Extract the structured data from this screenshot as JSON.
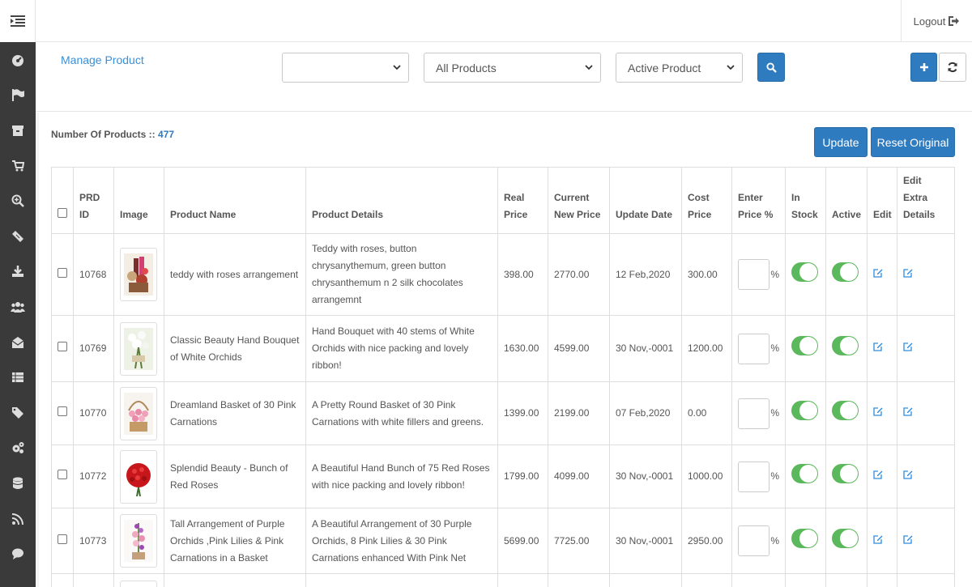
{
  "topbar": {
    "logout_label": "Logout"
  },
  "header": {
    "title": "Manage Product",
    "filter1_value": "",
    "filter2_value": "All Products",
    "filter3_value": "Active Product"
  },
  "summary": {
    "count_label": "Number Of Products ::",
    "count_value": "477"
  },
  "actions": {
    "update_label": "Update",
    "reset_label": "Reset Original"
  },
  "table": {
    "headers": {
      "prd_id": [
        "PRD",
        "ID"
      ],
      "image": "Image",
      "product_name": "Product Name",
      "product_details": "Product Details",
      "real_price": [
        "Real",
        "Price"
      ],
      "current_new_price": [
        "Current",
        "New Price"
      ],
      "update_date": "Update Date",
      "cost_price": [
        "Cost",
        "Price"
      ],
      "enter_price": [
        "Enter",
        "Price %"
      ],
      "in_stock": [
        "In",
        "Stock"
      ],
      "active": "Active",
      "edit": "Edit",
      "edit_extra": [
        "Edit",
        "Extra",
        "Details"
      ]
    },
    "percent_sign": "%",
    "rows": [
      {
        "id": "10768",
        "name": "teddy with roses arrangement",
        "details": "Teddy with roses, button chrysanythemum, green button chrysanthemum n 2 silk chocolates arrangemnt",
        "real_price": "398.00",
        "new_price": "2770.00",
        "update_date": "12 Feb,2020",
        "cost_price": "300.00",
        "in_stock": true,
        "active": true
      },
      {
        "id": "10769",
        "name": "Classic Beauty Hand Bouquet of White Orchids",
        "details": "Hand Bouquet with 40 stems of White Orchids with nice packing and lovely ribbon!",
        "real_price": "1630.00",
        "new_price": "4599.00",
        "update_date": "30 Nov,-0001",
        "cost_price": "1200.00",
        "in_stock": true,
        "active": true
      },
      {
        "id": "10770",
        "name": "Dreamland Basket of 30 Pink Carnations",
        "details": "A Pretty Round Basket of 30 Pink Carnations with white fillers and greens.",
        "real_price": "1399.00",
        "new_price": "2199.00",
        "update_date": "07 Feb,2020",
        "cost_price": "0.00",
        "in_stock": true,
        "active": true
      },
      {
        "id": "10772",
        "name": "Splendid Beauty - Bunch of Red Roses",
        "details": "A Beautiful Hand Bunch of 75 Red Roses with nice packing and lovely ribbon!",
        "real_price": "1799.00",
        "new_price": "4099.00",
        "update_date": "30 Nov,-0001",
        "cost_price": "1000.00",
        "in_stock": true,
        "active": true
      },
      {
        "id": "10773",
        "name": "Tall Arrangement of Purple Orchids ,Pink Lilies & Pink Carnations in a Basket",
        "details": "A Beautiful Arrangement of 30 Purple Orchids, 8 Pink Lilies & 30 Pink Carnations enhanced With Pink Net",
        "real_price": "5699.00",
        "new_price": "7725.00",
        "update_date": "30 Nov,-0001",
        "cost_price": "2950.00",
        "in_stock": true,
        "active": true
      }
    ]
  },
  "colors": {
    "accent": "#2f7bc0",
    "link": "#3a8fd6",
    "toggle_on": "#5cb85c",
    "sidebar": "#3a3a3a"
  }
}
